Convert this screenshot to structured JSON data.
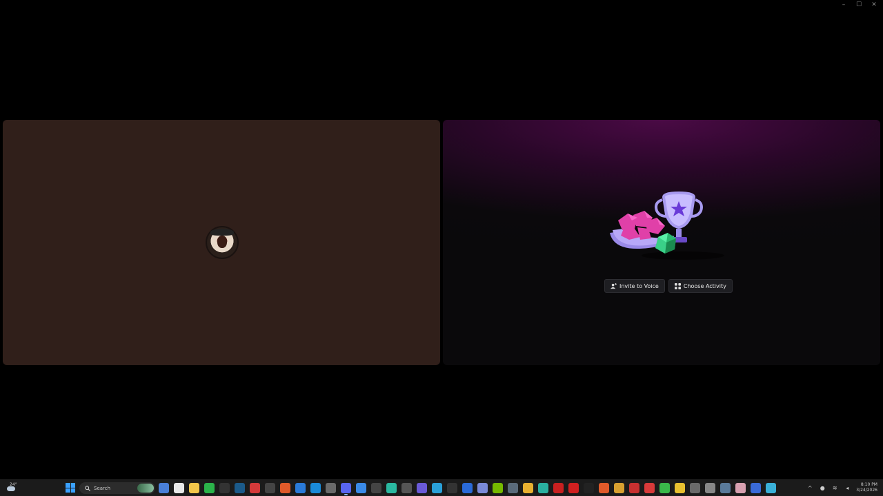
{
  "window": {
    "controls": {
      "minimize": "–",
      "maximize": "☐",
      "close": "✕"
    }
  },
  "left_tile": {
    "avatar_icon": "user-avatar"
  },
  "right_tile": {
    "illustration_icon": "trophy-gems-dice-illustration",
    "invite_label": "Invite to Voice",
    "choose_activity_label": "Choose Activity"
  },
  "taskbar": {
    "weather_temp": "24°",
    "search_placeholder": "Search",
    "clock_time": "8:10 PM",
    "clock_date": "3/24/2026",
    "apps": [
      {
        "name": "copilot",
        "color": "#4a7fd8"
      },
      {
        "name": "store",
        "color": "#e8e8e8"
      },
      {
        "name": "file-explorer",
        "color": "#f2c64a"
      },
      {
        "name": "xbox",
        "color": "#2bb34a"
      },
      {
        "name": "terminal",
        "color": "#333333"
      },
      {
        "name": "steam",
        "color": "#1b5a8a"
      },
      {
        "name": "app-red",
        "color": "#d43a3a"
      },
      {
        "name": "obs",
        "color": "#444444"
      },
      {
        "name": "brave",
        "color": "#e05a2a"
      },
      {
        "name": "edge-blue",
        "color": "#2a7ad8"
      },
      {
        "name": "battlenet",
        "color": "#1a8ad8"
      },
      {
        "name": "notepad",
        "color": "#6a6a6a"
      },
      {
        "name": "discord",
        "color": "#5865f2",
        "active": true
      },
      {
        "name": "chrome-badge",
        "color": "#3a8ae8"
      },
      {
        "name": "react",
        "color": "#444444"
      },
      {
        "name": "teal-app",
        "color": "#2ab8a0"
      },
      {
        "name": "settings",
        "color": "#555555"
      },
      {
        "name": "arrow-app",
        "color": "#6a5ad8"
      },
      {
        "name": "telegram",
        "color": "#2aa0d8"
      },
      {
        "name": "epic",
        "color": "#333333"
      },
      {
        "name": "vscode",
        "color": "#2a6ad8"
      },
      {
        "name": "photos",
        "color": "#7a8ad8"
      },
      {
        "name": "nvidia",
        "color": "#76b900"
      },
      {
        "name": "gear-app",
        "color": "#5a6a7a"
      },
      {
        "name": "chrome",
        "color": "#e8b030"
      },
      {
        "name": "edge",
        "color": "#2ab0a0"
      },
      {
        "name": "opera",
        "color": "#c82020"
      },
      {
        "name": "acrobat",
        "color": "#d02020"
      },
      {
        "name": "tiktok",
        "color": "#222222"
      },
      {
        "name": "brave-2",
        "color": "#e05a2a"
      },
      {
        "name": "capcut",
        "color": "#d8a030"
      },
      {
        "name": "red-app",
        "color": "#c83030"
      },
      {
        "name": "gamepad",
        "color": "#d83a3a"
      },
      {
        "name": "green-app",
        "color": "#3ab84a"
      },
      {
        "name": "yellow-app",
        "color": "#e8c030"
      },
      {
        "name": "misc-1",
        "color": "#6a6a6a"
      },
      {
        "name": "home",
        "color": "#888888"
      },
      {
        "name": "misc-2",
        "color": "#5a7a9a"
      },
      {
        "name": "misc-3",
        "color": "#d8a0b0"
      },
      {
        "name": "misc-4",
        "color": "#3a6ad8"
      },
      {
        "name": "globe",
        "color": "#3ab0d8"
      }
    ]
  }
}
